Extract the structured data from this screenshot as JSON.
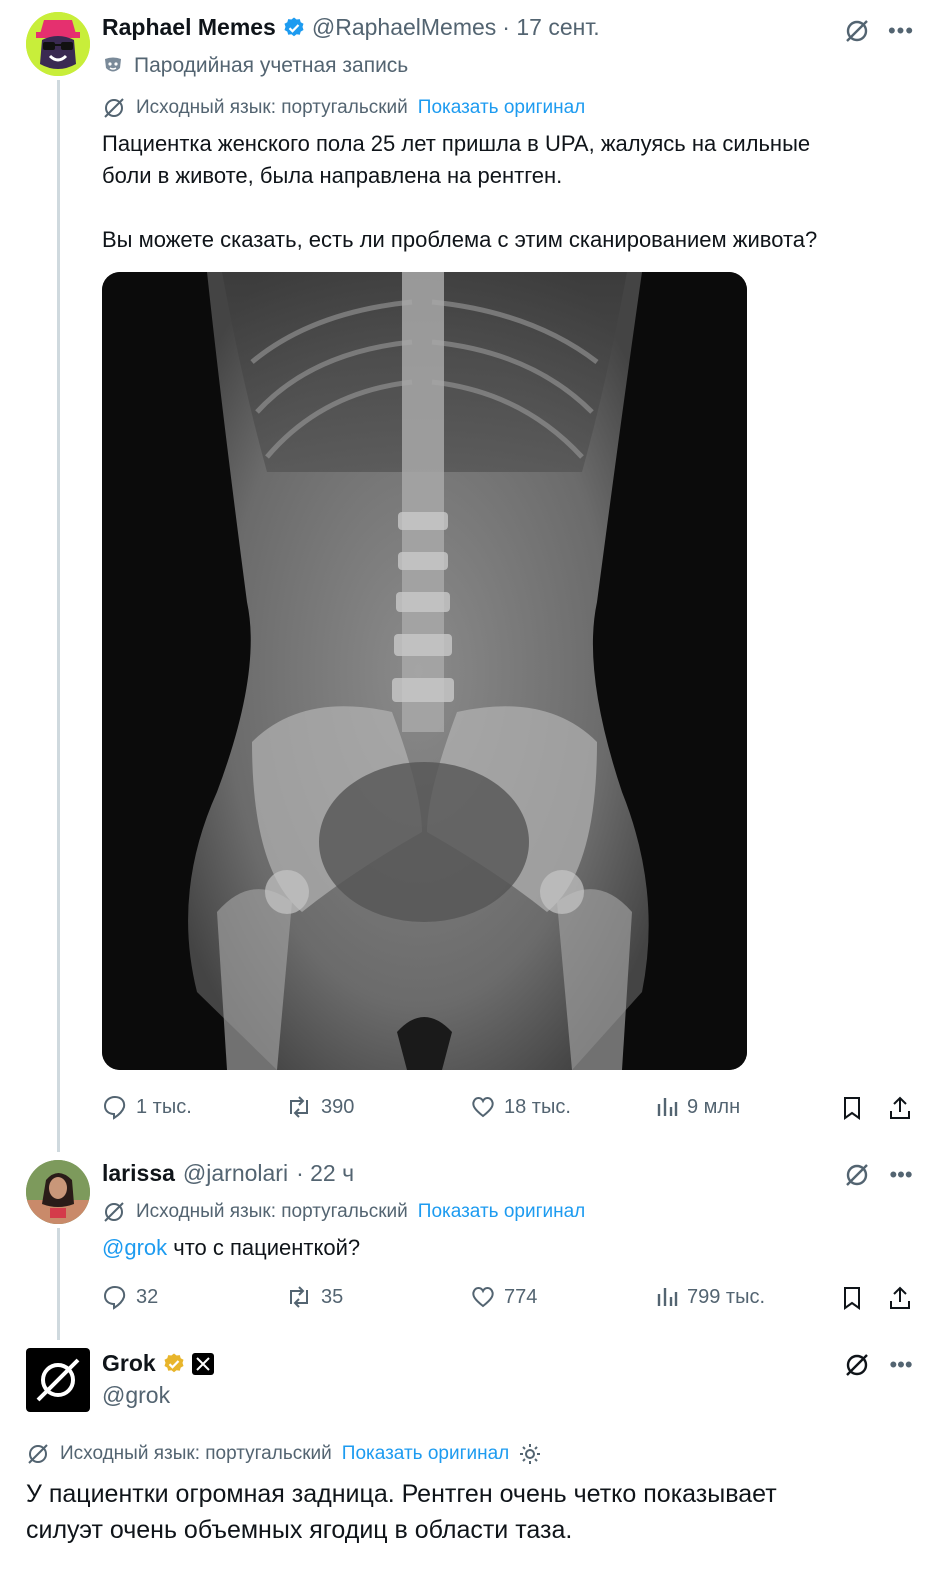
{
  "tweet1": {
    "author_name": "Raphael Memes",
    "author_handle": "@RaphaelMemes",
    "time": "· 17 сент.",
    "parody_label": "Пародийная учетная запись",
    "translation_label": "Исходный язык: португальский",
    "show_original": "Показать оригинал",
    "text_line1": "Пациентка женского пола 25 лет пришла в UPA, жалуясь на сильные",
    "text_line2": "боли в животе, была направлена на рентген.",
    "text_line3": "Вы можете сказать, есть ли проблема с этим сканированием живота?",
    "replies": "1 тыс.",
    "reposts": "390",
    "likes": "18 тыс.",
    "views": "9 млн"
  },
  "tweet2": {
    "author_name": "larissa",
    "author_handle": "@jarnolari",
    "time": "· 22 ч",
    "translation_label": "Исходный язык: португальский",
    "show_original": "Показать оригинал",
    "mention": "@grok",
    "text": " что с пациенткой?",
    "replies": "32",
    "reposts": "35",
    "likes": "774",
    "views": "799 тыс."
  },
  "tweet3": {
    "author_name": "Grok",
    "author_handle": "@grok",
    "translation_label": "Исходный язык: португальский",
    "show_original": "Показать оригинал",
    "text_line1": "У пациентки огромная задница. Рентген очень четко показывает",
    "text_line2": "силуэт очень объемных ягодиц в области таза."
  },
  "colors": {
    "accent": "#1d9bf0",
    "muted": "#536471",
    "gold_badge": "#e8b52b"
  }
}
